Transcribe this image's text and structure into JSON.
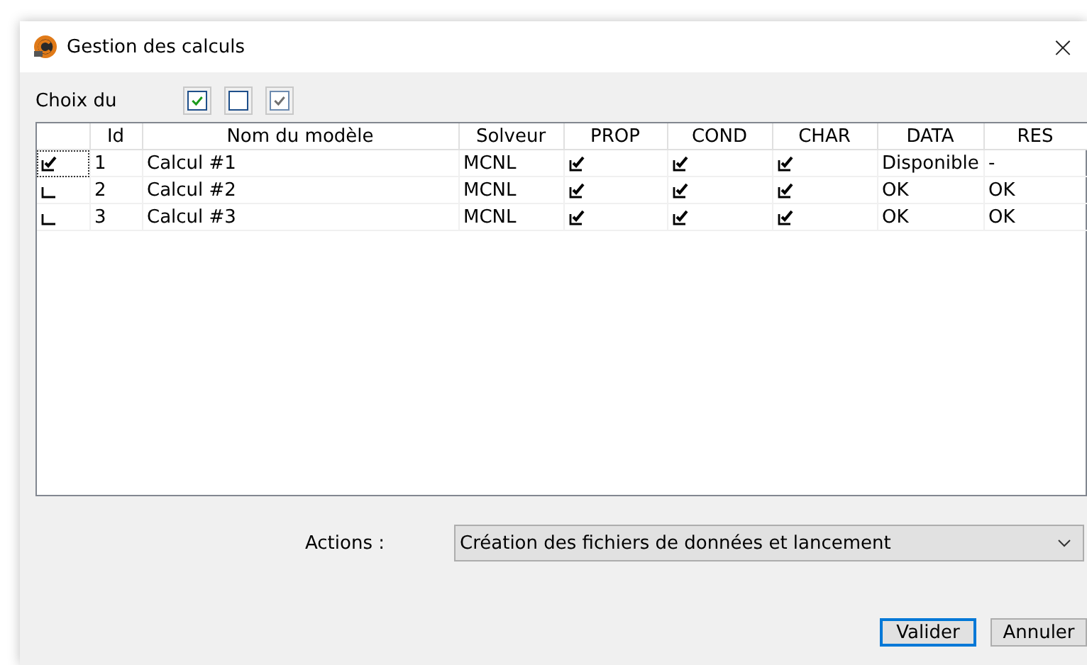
{
  "window": {
    "title": "Gestion des calculs",
    "close": "×"
  },
  "choice": {
    "label": "Choix du",
    "boxes": [
      {
        "checked": true,
        "disabled": false
      },
      {
        "checked": false,
        "disabled": false
      },
      {
        "checked": true,
        "disabled": true
      }
    ]
  },
  "table": {
    "columns": [
      "",
      "Id",
      "Nom du modèle",
      "Solveur",
      "PROP",
      "COND",
      "CHAR",
      "DATA",
      "RES"
    ],
    "rows": [
      {
        "selected": true,
        "id": "1",
        "name": "Calcul #1",
        "solver": "MCNL",
        "prop": true,
        "cond": true,
        "char": true,
        "data": "Disponible",
        "res": "-"
      },
      {
        "selected": false,
        "id": "2",
        "name": "Calcul #2",
        "solver": "MCNL",
        "prop": true,
        "cond": true,
        "char": true,
        "data": "OK",
        "res": "OK"
      },
      {
        "selected": false,
        "id": "3",
        "name": "Calcul #3",
        "solver": "MCNL",
        "prop": true,
        "cond": true,
        "char": true,
        "data": "OK",
        "res": "OK"
      }
    ]
  },
  "actions": {
    "label": "Actions :",
    "value": "Création des fichiers de données et lancement"
  },
  "buttons": [
    {
      "label": "Valider",
      "default": true
    },
    {
      "label": "Annuler",
      "default": false
    }
  ]
}
